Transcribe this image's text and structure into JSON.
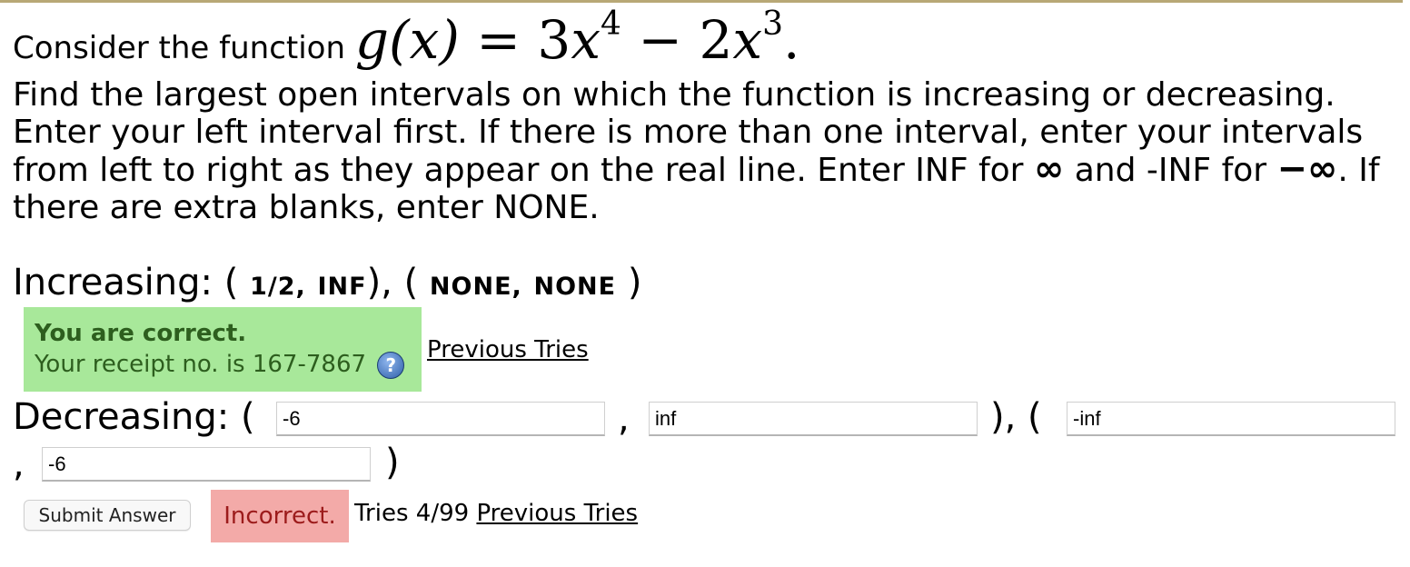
{
  "question": {
    "intro": "Consider the function",
    "function_lhs": "g(x)",
    "equals": "=",
    "term1_coef": "3x",
    "term1_exp": "4",
    "minus": "−",
    "term2_coef": "2x",
    "term2_exp": "3",
    "period": ".",
    "instructions_part1": "Find the largest open intervals on which the function is increasing or decreasing. Enter your left interval first. If there is more than one interval, enter your intervals from left to right as they appear on the real line. Enter INF for",
    "infinity_symbol": "∞",
    "instructions_part2": "and -INF for",
    "neg_infinity_symbol": "−∞",
    "instructions_part3": ". If there are extra blanks, enter NONE."
  },
  "increasing": {
    "label": "Increasing:",
    "open_paren": "(",
    "a1": "1/2",
    "comma": ",",
    "b1": "INF",
    "close_sep": "), (",
    "a2": "NONE",
    "b2": "NONE",
    "close_paren": ")"
  },
  "correct_feedback": {
    "title": "You are correct.",
    "receipt": "Your receipt no. is 167-7867",
    "help_icon_glyph": "?",
    "previous_tries": "Previous Tries"
  },
  "decreasing": {
    "label": "Decreasing:",
    "open_paren": "(",
    "comma": ",",
    "close_sep": "), (",
    "close_paren": ")",
    "field1_value": "-6",
    "field2_value": "inf",
    "field3_value": "-inf",
    "field4_value": "-6"
  },
  "submission": {
    "submit_label": "Submit Answer",
    "status": "Incorrect.",
    "tries": "Tries 4/99",
    "previous_tries": "Previous Tries"
  },
  "colors": {
    "correct_bg": "#a8e89a",
    "correct_text": "#2d5e1e",
    "incorrect_bg": "#f3aaa8",
    "incorrect_text": "#9c1b1b"
  }
}
